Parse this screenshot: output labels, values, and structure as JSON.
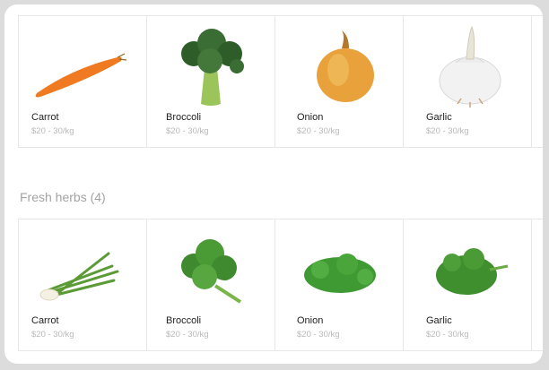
{
  "sections": [
    {
      "title": "",
      "items": [
        {
          "name": "Carrot",
          "price": "$20 - 30/kg",
          "icon": "carrot-image"
        },
        {
          "name": "Broccoli",
          "price": "$20 - 30/kg",
          "icon": "broccoli-image"
        },
        {
          "name": "Onion",
          "price": "$20 - 30/kg",
          "icon": "onion-image"
        },
        {
          "name": "Garlic",
          "price": "$20 - 30/kg",
          "icon": "garlic-image"
        }
      ]
    },
    {
      "title": "Fresh herbs (4)",
      "items": [
        {
          "name": "Carrot",
          "price": "$20 - 30/kg",
          "icon": "spring-onion-image"
        },
        {
          "name": "Broccoli",
          "price": "$20 - 30/kg",
          "icon": "cilantro-image"
        },
        {
          "name": "Onion",
          "price": "$20 - 30/kg",
          "icon": "parsley-image"
        },
        {
          "name": "Garlic",
          "price": "$20 - 30/kg",
          "icon": "celery-leaf-image"
        }
      ]
    }
  ]
}
